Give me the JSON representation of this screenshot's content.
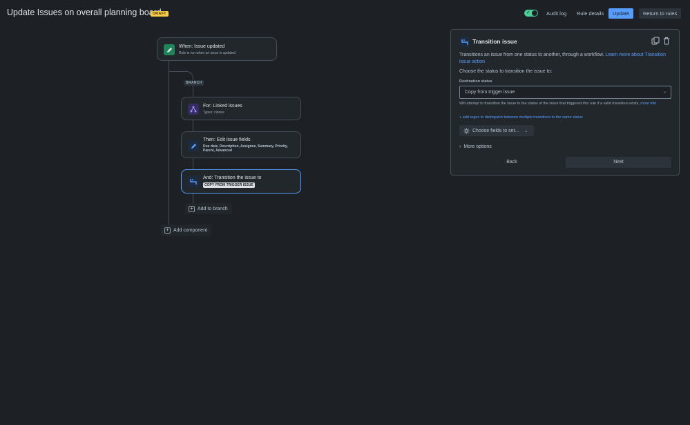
{
  "header": {
    "title": "Update Issues on overall planning board",
    "badge": "DRAFT",
    "audit_log": "Audit log",
    "rule_details": "Rule details",
    "update": "Update",
    "return": "Return to rules",
    "rule_enabled": true
  },
  "canvas": {
    "branch_label": "BRANCH",
    "trigger": {
      "title": "When: Issue updated",
      "subtitle": "Rule is run when an issue is updated.",
      "icon": "pencil-icon"
    },
    "branch": {
      "title": "For: Linked issues",
      "subtitle": "Types: clones",
      "icon": "branch-icon"
    },
    "edit": {
      "title": "Then: Edit issue fields",
      "subtitle": "Due date, Description, Assignee, Summary, Priority, Parent, Advanced",
      "icon": "pencil-icon"
    },
    "transition": {
      "title": "And: Transition the issue to",
      "chip": "COPY FROM TRIGGER ISSUE",
      "icon": "transition-icon"
    },
    "add_to_branch": "Add to branch",
    "add_component": "Add component"
  },
  "panel": {
    "title": "Transition issue",
    "desc_text": "Transitions an issue from one status to another, through a workflow. ",
    "desc_link": "Learn more about Transition issue action",
    "question": "Choose the status to transition the issue to:",
    "field_label": "Destination status",
    "select_value": "Copy from trigger issue",
    "hint_text": "Will attempt to transition the issue to the status of the issue that triggered this rule if a valid transition exists, ",
    "hint_link": "more info.",
    "regex_link": "+ add regex to distinguish between multiple transitions to the same status",
    "fields_button": "Choose fields to set...",
    "more_options": "More options",
    "back": "Back",
    "next": "Next"
  },
  "colors": {
    "background": "#1d2125",
    "accent": "#579dff",
    "toggle_on": "#4bce97",
    "draft_badge": "#f5cd47",
    "edit_icon_bg": "#1f845a",
    "branch_icon_bg": "#352c63"
  }
}
